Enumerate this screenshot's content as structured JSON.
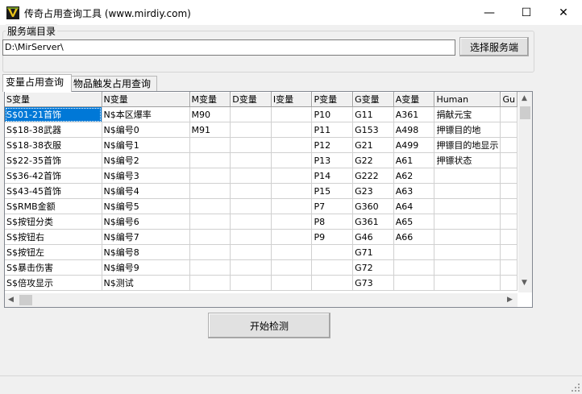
{
  "window": {
    "title": "传奇占用查询工具 (www.mirdiy.com)",
    "minimize": "—",
    "maximize": "☐",
    "close": "✕"
  },
  "server": {
    "group_label": "服务端目录",
    "path_value": "D:\\MirServer\\",
    "choose_button": "选择服务端"
  },
  "tabs": [
    {
      "label": "变量占用查询",
      "active": true
    },
    {
      "label": "物品触发占用查询",
      "active": false
    }
  ],
  "table": {
    "columns": [
      "S变量",
      "N变量",
      "M变量",
      "D变量",
      "I变量",
      "P变量",
      "G变量",
      "A变量",
      "Human",
      "Gu"
    ],
    "rows": [
      [
        "S$01-21首饰",
        "N$本区爆率",
        "M90",
        "",
        "",
        "P10",
        "G11",
        "A361",
        "捐献元宝",
        ""
      ],
      [
        "S$18-38武器",
        "N$编号0",
        "M91",
        "",
        "",
        "P11",
        "G153",
        "A498",
        "押镖目的地",
        ""
      ],
      [
        "S$18-38衣服",
        "N$编号1",
        "",
        "",
        "",
        "P12",
        "G21",
        "A499",
        "押镖目的地显示",
        ""
      ],
      [
        "S$22-35首饰",
        "N$编号2",
        "",
        "",
        "",
        "P13",
        "G22",
        "A61",
        "押镖状态",
        ""
      ],
      [
        "S$36-42首饰",
        "N$编号3",
        "",
        "",
        "",
        "P14",
        "G222",
        "A62",
        "",
        ""
      ],
      [
        "S$43-45首饰",
        "N$编号4",
        "",
        "",
        "",
        "P15",
        "G23",
        "A63",
        "",
        ""
      ],
      [
        "S$RMB金额",
        "N$编号5",
        "",
        "",
        "",
        "P7",
        "G360",
        "A64",
        "",
        ""
      ],
      [
        "S$按钮分类",
        "N$编号6",
        "",
        "",
        "",
        "P8",
        "G361",
        "A65",
        "",
        ""
      ],
      [
        "S$按钮右",
        "N$编号7",
        "",
        "",
        "",
        "P9",
        "G46",
        "A66",
        "",
        ""
      ],
      [
        "S$按钮左",
        "N$编号8",
        "",
        "",
        "",
        "",
        "G71",
        "",
        "",
        ""
      ],
      [
        "S$暴击伤害",
        "N$编号9",
        "",
        "",
        "",
        "",
        "G72",
        "",
        "",
        ""
      ],
      [
        "S$倍攻显示",
        "N$测试",
        "",
        "",
        "",
        "",
        "G73",
        "",
        "",
        ""
      ]
    ]
  },
  "actions": {
    "start_button": "开始检测"
  },
  "scroll_arrows": {
    "up": "▲",
    "down": "▼",
    "left": "◀",
    "right": "▶"
  }
}
